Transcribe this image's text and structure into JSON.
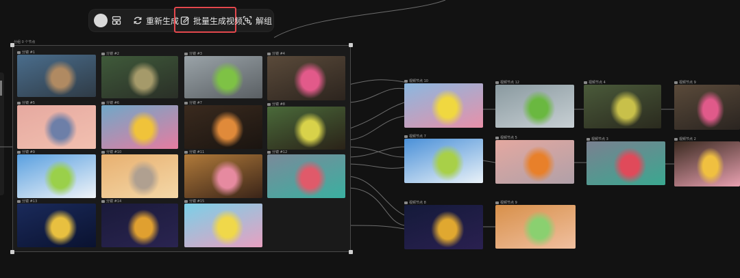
{
  "toolbar": {
    "regenerate_label": "重新生成",
    "batch_video_label": "批量生成视频",
    "ungroup_label": "解组"
  },
  "group": {
    "title": "分组 0 个节点"
  },
  "storyboard_nodes": [
    {
      "label": "分镜 #1",
      "palette": [
        "#4a6d8c",
        "#b08a62",
        "#2f3b46"
      ]
    },
    {
      "label": "分镜 #2",
      "palette": [
        "#3f5a3a",
        "#a59a6a",
        "#2a2f27"
      ]
    },
    {
      "label": "分镜 #3",
      "palette": [
        "#9aa3a8",
        "#7ec245",
        "#5a5f63"
      ]
    },
    {
      "label": "分镜 #4",
      "palette": [
        "#5a4a3a",
        "#e25a8a",
        "#2c241e"
      ]
    },
    {
      "label": "分镜 #5",
      "palette": [
        "#e6a9a0",
        "#6d7fa8",
        "#f2c0b0"
      ]
    },
    {
      "label": "分镜 #6",
      "palette": [
        "#6fa8c8",
        "#f0c33a",
        "#e67ca0"
      ]
    },
    {
      "label": "分镜 #7",
      "palette": [
        "#3a2a1e",
        "#e08a3a",
        "#1a1410"
      ]
    },
    {
      "label": "分镜 #8",
      "palette": [
        "#4a6a3a",
        "#d8d24a",
        "#2a2218"
      ]
    },
    {
      "label": "分镜 #9",
      "palette": [
        "#5aa0e0",
        "#9ad04a",
        "#f0f4f8"
      ]
    },
    {
      "label": "分镜 #10",
      "palette": [
        "#e8b070",
        "#b0a090",
        "#f4d8a8"
      ]
    },
    {
      "label": "分镜 #11",
      "palette": [
        "#b07a3a",
        "#e68aa0",
        "#3a2418"
      ]
    },
    {
      "label": "分镜 #12",
      "palette": [
        "#7a8a9a",
        "#e05a6a",
        "#3ab0a0"
      ]
    },
    {
      "label": "分镜 #13",
      "palette": [
        "#1a2a5a",
        "#e8c040",
        "#0a1230"
      ]
    },
    {
      "label": "分镜 #14",
      "palette": [
        "#1a1a3a",
        "#e0a030",
        "#2a2450"
      ]
    },
    {
      "label": "分镜 #15",
      "palette": [
        "#7ad0e8",
        "#f0d84a",
        "#e8a0c0"
      ]
    }
  ],
  "video_nodes": [
    {
      "label": "视频节点 10",
      "palette": [
        "#8ab8e0",
        "#f0d840",
        "#e890a8"
      ]
    },
    {
      "label": "视频节点 12",
      "palette": [
        "#8a9aa0",
        "#6ab840",
        "#c8d0d4"
      ]
    },
    {
      "label": "视频节点 4",
      "palette": [
        "#4a5a3a",
        "#c8c04a",
        "#2a2a1e"
      ]
    },
    {
      "label": "视频节点 9",
      "palette": [
        "#5a4a3a",
        "#e05a8a",
        "#2a2420"
      ]
    },
    {
      "label": "视频节点 7",
      "palette": [
        "#4a90d8",
        "#a8d048",
        "#eaf2f8"
      ]
    },
    {
      "label": "视频节点 5",
      "palette": [
        "#e4a8a0",
        "#e8802a",
        "#b0a0a8"
      ]
    },
    {
      "label": "视频节点 3",
      "palette": [
        "#7a8090",
        "#e04a5a",
        "#3aa890"
      ]
    },
    {
      "label": "视频节点 2",
      "palette": [
        "#3a2a20",
        "#f0c040",
        "#e8a0b0"
      ]
    },
    {
      "label": "视频节点 8",
      "palette": [
        "#141a3a",
        "#e0a830",
        "#2a2050"
      ]
    },
    {
      "label": "视频节点 9",
      "palette": [
        "#d8904a",
        "#8ad070",
        "#f0c0a0"
      ]
    }
  ],
  "colors": {
    "highlight": "#e5484d",
    "background": "#121212",
    "group_border": "#4a4a4a"
  }
}
